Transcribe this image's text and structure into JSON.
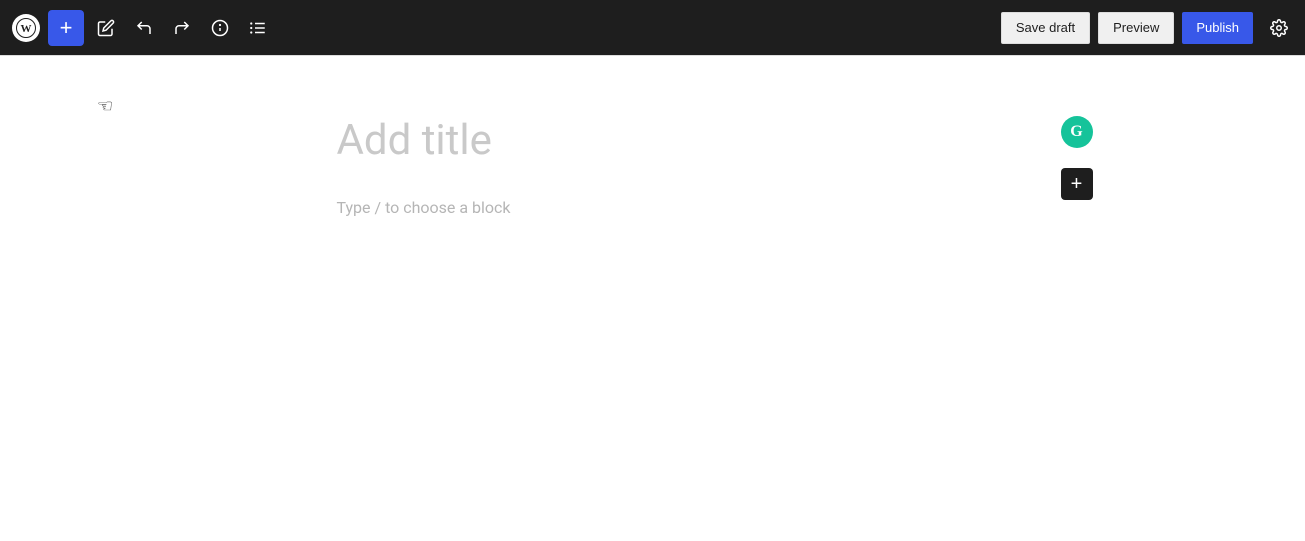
{
  "toolbar": {
    "wp_logo_text": "W",
    "add_button_label": "+",
    "save_draft_label": "Save draft",
    "preview_label": "Preview",
    "publish_label": "Publish"
  },
  "editor": {
    "title_placeholder": "Add title",
    "block_placeholder": "Type / to choose a block"
  },
  "grammarly": {
    "letter": "G"
  },
  "add_block": {
    "label": "+"
  }
}
